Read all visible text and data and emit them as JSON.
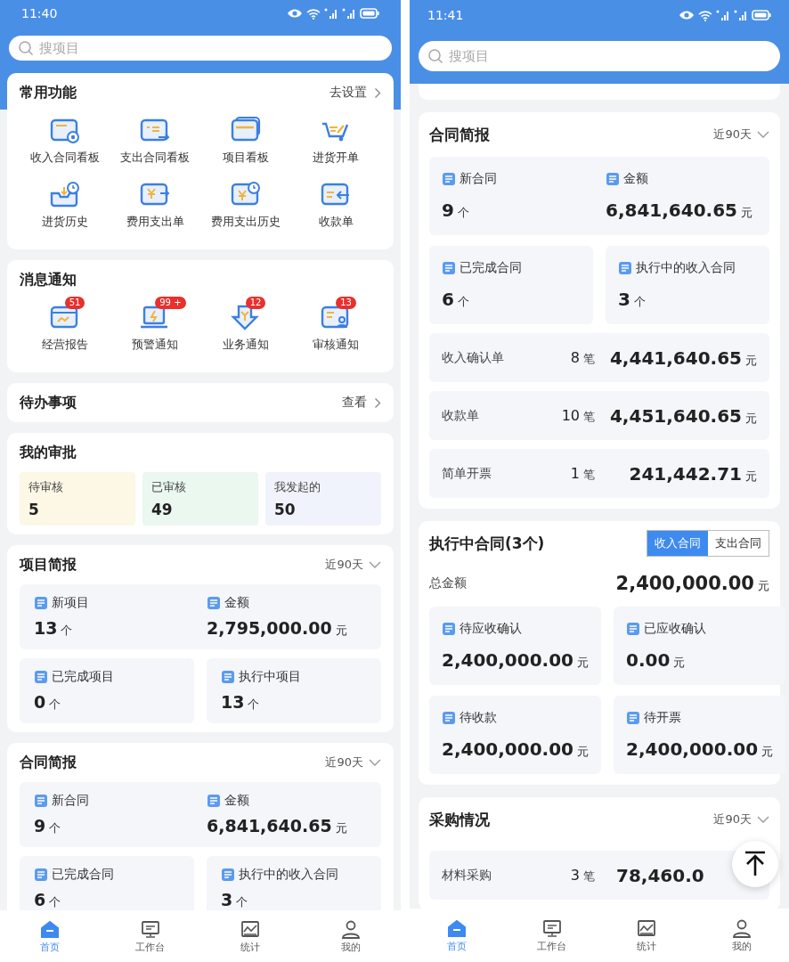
{
  "screens": [
    {
      "status_time": "11:40",
      "search": {
        "placeholder": "搜项目"
      },
      "sections": [
        {
          "kind": "grid",
          "title": "常用功能",
          "action": "去设置",
          "items": [
            {
              "label": "收入合同看板"
            },
            {
              "label": "支出合同看板"
            },
            {
              "label": "项目看板"
            },
            {
              "label": "进货开单"
            },
            {
              "label": "进货历史"
            },
            {
              "label": "费用支出单"
            },
            {
              "label": "费用支出历史"
            },
            {
              "label": "收款单"
            }
          ]
        },
        {
          "kind": "notices",
          "title": "消息通知",
          "items": [
            {
              "label": "经营报告",
              "badge": "51"
            },
            {
              "label": "预警通知",
              "badge": "99 +"
            },
            {
              "label": "业务通知",
              "badge": "12"
            },
            {
              "label": "审核通知",
              "badge": "13"
            }
          ]
        },
        {
          "kind": "link",
          "title": "待办事项",
          "action": "查看"
        },
        {
          "kind": "approvals",
          "title": "我的审批",
          "items": [
            {
              "label": "待审核",
              "value": "5",
              "color": "#fdf7e6"
            },
            {
              "label": "已审核",
              "value": "49",
              "color": "#eaf8ef"
            },
            {
              "label": "我发起的",
              "value": "50",
              "color": "#f0f3fc"
            }
          ]
        },
        {
          "kind": "brief",
          "title": "项目简报",
          "period": "近90天",
          "panels": [
            {
              "stats": [
                {
                  "label": "新项目",
                  "value": "13",
                  "unit": "个"
                },
                {
                  "label": "金额",
                  "value": "2,795,000.00",
                  "unit": "元"
                }
              ]
            },
            {
              "stats": [
                {
                  "label": "已完成项目",
                  "value": "0",
                  "unit": "个"
                }
              ]
            },
            {
              "stats": [
                {
                  "label": "执行中项目",
                  "value": "13",
                  "unit": "个"
                }
              ]
            }
          ]
        },
        {
          "kind": "brief",
          "title": "合同简报",
          "period": "近90天",
          "panels": [
            {
              "stats": [
                {
                  "label": "新合同",
                  "value": "9",
                  "unit": "个"
                },
                {
                  "label": "金额",
                  "value": "6,841,640.65",
                  "unit": "元"
                }
              ]
            },
            {
              "stats": [
                {
                  "label": "已完成合同",
                  "value": "6",
                  "unit": "个"
                }
              ]
            },
            {
              "stats": [
                {
                  "label": "执行中的收入合同",
                  "value": "3",
                  "unit": "个"
                }
              ]
            }
          ]
        }
      ],
      "tabs": [
        {
          "label": "首页",
          "selected": true
        },
        {
          "label": "工作台",
          "selected": false
        },
        {
          "label": "统计",
          "selected": false
        },
        {
          "label": "我的",
          "selected": false
        }
      ]
    },
    {
      "status_time": "11:41",
      "search": {
        "placeholder": "搜项目"
      },
      "sections": [
        {
          "kind": "stub"
        },
        {
          "kind": "brief",
          "title": "合同简报",
          "period": "近90天",
          "panels": [
            {
              "stats": [
                {
                  "label": "新合同",
                  "value": "9",
                  "unit": "个"
                },
                {
                  "label": "金额",
                  "value": "6,841,640.65",
                  "unit": "元"
                }
              ]
            },
            {
              "stats": [
                {
                  "label": "已完成合同",
                  "value": "6",
                  "unit": "个"
                }
              ]
            },
            {
              "stats": [
                {
                  "label": "执行中的收入合同",
                  "value": "3",
                  "unit": "个"
                }
              ]
            }
          ],
          "lines": [
            {
              "label": "收入确认单",
              "count": "8",
              "count_unit": "笔",
              "value": "4,441,640.65",
              "unit": "元"
            },
            {
              "label": "收款单",
              "count": "10",
              "count_unit": "笔",
              "value": "4,451,640.65",
              "unit": "元"
            },
            {
              "label": "简单开票",
              "count": "1",
              "count_unit": "笔",
              "value": "241,442.71",
              "unit": "元"
            }
          ]
        },
        {
          "kind": "executing",
          "title": "执行中合同(3个)",
          "toggle": [
            {
              "label": "收入合同",
              "selected": true
            },
            {
              "label": "支出合同",
              "selected": false
            }
          ],
          "total_label": "总金额",
          "total": "2,400,000.00",
          "unit": "元",
          "panels": [
            {
              "stats": [
                {
                  "label": "待应收确认",
                  "value": "2,400,000.00",
                  "unit": "元"
                }
              ]
            },
            {
              "stats": [
                {
                  "label": "已应收确认",
                  "value": "0.00",
                  "unit": "元"
                }
              ]
            },
            {
              "stats": [
                {
                  "label": "待收款",
                  "value": "2,400,000.00",
                  "unit": "元"
                }
              ]
            },
            {
              "stats": [
                {
                  "label": "待开票",
                  "value": "2,400,000.00",
                  "unit": "元"
                }
              ]
            }
          ]
        },
        {
          "kind": "brief",
          "title": "采购情况",
          "period": "近90天",
          "lines": [
            {
              "label": "材料采购",
              "count": "3",
              "count_unit": "笔",
              "value": "78,460.0"
            }
          ]
        }
      ],
      "back_to_top": true,
      "tabs": [
        {
          "label": "首页",
          "selected": true
        },
        {
          "label": "工作台",
          "selected": false
        },
        {
          "label": "统计",
          "selected": false
        },
        {
          "label": "我的",
          "selected": false
        }
      ]
    }
  ]
}
